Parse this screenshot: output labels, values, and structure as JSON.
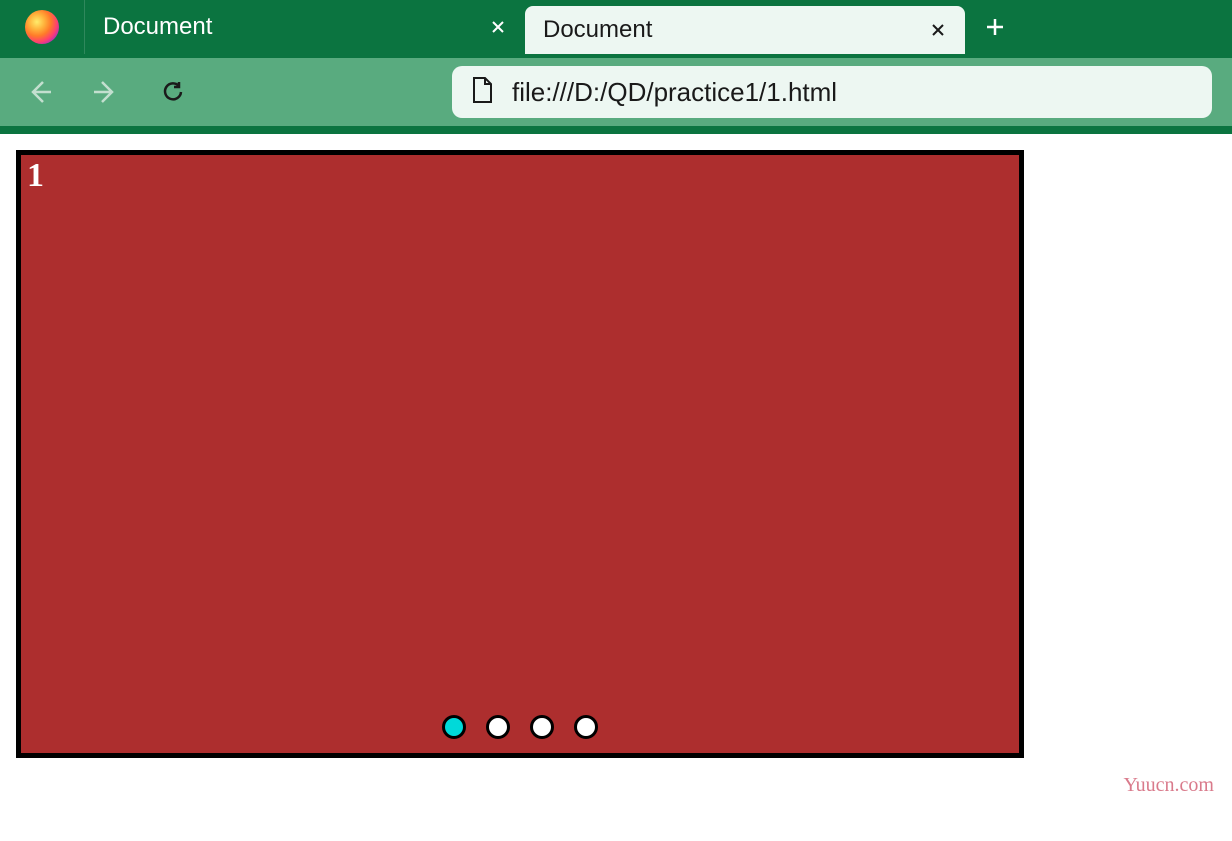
{
  "tabs": [
    {
      "title": "Document",
      "active": false
    },
    {
      "title": "Document",
      "active": true
    }
  ],
  "url": "file:///D:/QD/practice1/1.html",
  "carousel": {
    "slide_number": "1",
    "dots": [
      {
        "active": true
      },
      {
        "active": false
      },
      {
        "active": false
      },
      {
        "active": false
      }
    ]
  },
  "watermark": "Yuucn.com"
}
